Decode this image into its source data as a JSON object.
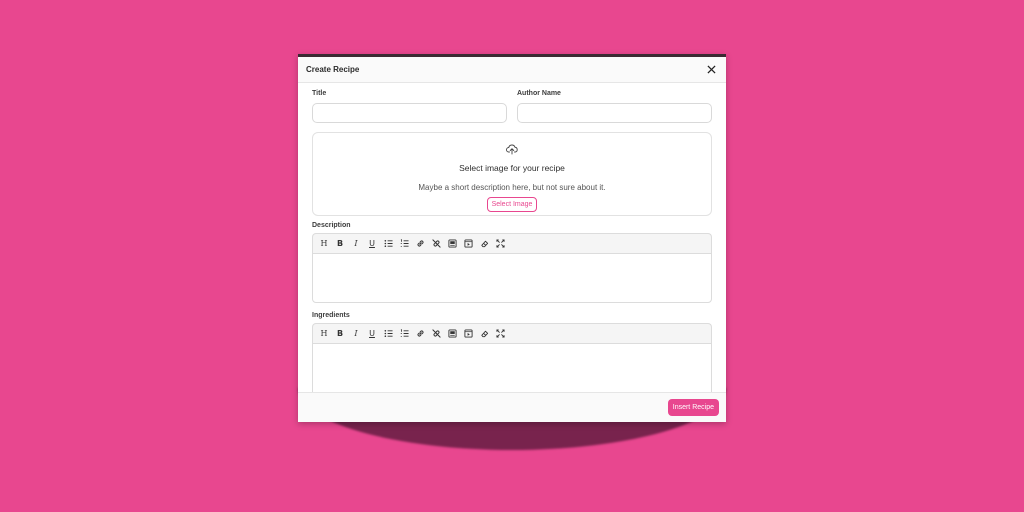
{
  "colors": {
    "background": "#e8478f",
    "accent": "#e8478f",
    "shadow": "#78234d"
  },
  "modal": {
    "title": "Create Recipe",
    "close_icon": "close-icon"
  },
  "form": {
    "title_label": "Title",
    "title_value": "",
    "author_label": "Author Name",
    "author_value": ""
  },
  "upload": {
    "icon": "cloud-upload-icon",
    "title": "Select image for your recipe",
    "description": "Maybe a short description here, but not sure about it.",
    "button_label": "Select Image"
  },
  "description_editor": {
    "label": "Description",
    "value": ""
  },
  "ingredients_editor": {
    "label": "Ingredients",
    "value": ""
  },
  "toolbar": {
    "buttons": [
      "heading-icon",
      "bold-icon",
      "italic-icon",
      "underline-icon",
      "bullet-list-icon",
      "numbered-list-icon",
      "link-icon",
      "unlink-icon",
      "image-icon",
      "video-icon",
      "eraser-icon",
      "fullscreen-icon"
    ],
    "heading_glyph": "H",
    "bold_glyph": "B",
    "italic_glyph": "I",
    "underline_glyph": "U"
  },
  "footer": {
    "insert_label": "Insert Recipe"
  }
}
